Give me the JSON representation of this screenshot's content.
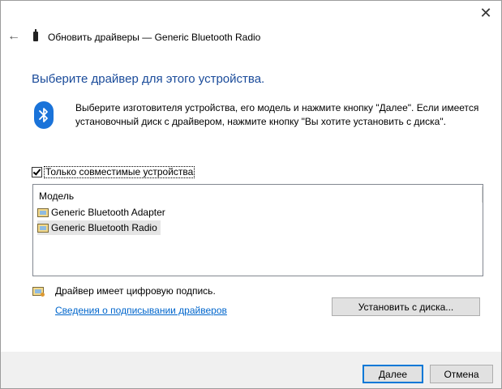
{
  "window": {
    "title": "Обновить драйверы — Generic Bluetooth Radio",
    "close_glyph": "✕",
    "back_glyph": "←"
  },
  "heading": "Выберите драйвер для этого устройства.",
  "description": "Выберите изготовителя устройства, его модель и нажмите кнопку \"Далее\". Если имеется установочный диск с  драйвером, нажмите кнопку \"Вы хотите установить с диска\".",
  "compatible_checkbox": {
    "label": "Только совместимые устройства",
    "checked": true
  },
  "model_list": {
    "header": "Модель",
    "items": [
      {
        "label": "Generic Bluetooth Adapter",
        "selected": false
      },
      {
        "label": "Generic Bluetooth Radio",
        "selected": true
      }
    ]
  },
  "signature": {
    "text": "Драйвер имеет цифровую подпись.",
    "link": "Сведения о подписывании драйверов"
  },
  "buttons": {
    "install_from_disk": "Установить с диска...",
    "next": "Далее",
    "cancel": "Отмена"
  },
  "icons": {
    "bluetooth": "bluetooth-icon",
    "device": "usb-device-icon",
    "driver": "driver-chip-icon",
    "signature": "signed-driver-icon"
  },
  "colors": {
    "heading": "#1a4b9a",
    "link": "#0066cc",
    "bluetooth_badge": "#1a73d9",
    "default_button_border": "#0078d7"
  }
}
